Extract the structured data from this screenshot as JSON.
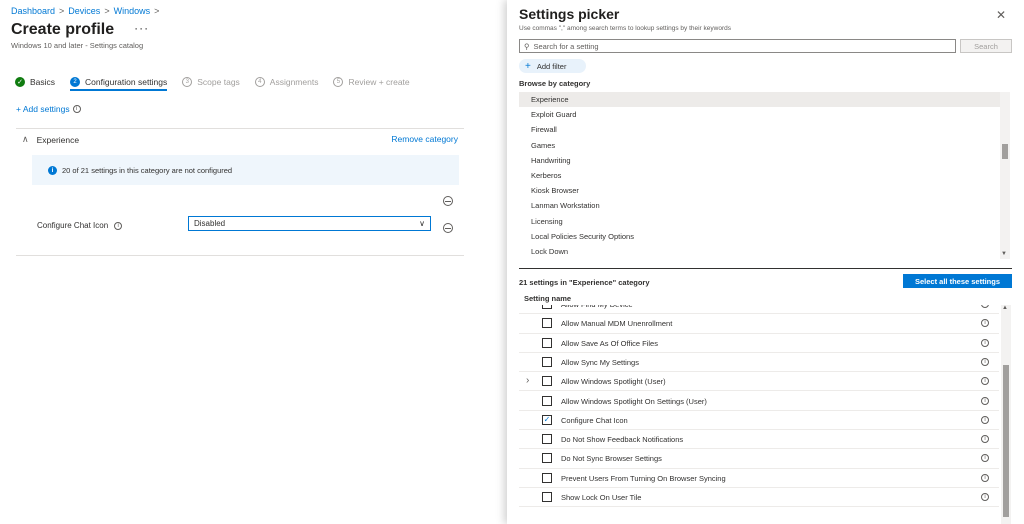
{
  "breadcrumb": [
    "Dashboard",
    "Devices",
    "Windows"
  ],
  "breadcrumb_sep": ">",
  "page": {
    "title": "Create profile",
    "more": "···",
    "subtitle": "Windows 10 and later - Settings catalog"
  },
  "wizard": {
    "steps": [
      {
        "num": "✓",
        "label": "Basics",
        "state": "done"
      },
      {
        "num": "2",
        "label": "Configuration settings",
        "state": "active"
      },
      {
        "num": "3",
        "label": "Scope tags",
        "state": "pending"
      },
      {
        "num": "4",
        "label": "Assignments",
        "state": "pending"
      },
      {
        "num": "5",
        "label": "Review + create",
        "state": "pending"
      }
    ]
  },
  "add_settings": {
    "label": "+ Add settings",
    "info": "i"
  },
  "category": {
    "name": "Experience",
    "collapse_icon": "chevron-up-icon",
    "remove_label": "Remove category",
    "info_text": "20 of 21 settings in this category are not configured",
    "info_glyph": "i",
    "setting_label": "Configure Chat Icon",
    "setting_info": "i",
    "dropdown_value": "Disabled",
    "dropdown_chevron": "∨"
  },
  "picker": {
    "title": "Settings picker",
    "close": "✕",
    "hint": "Use commas \",\" among search terms to lookup settings by their keywords",
    "search_placeholder": "Search for a setting",
    "search_icon": "⚲",
    "search_button": "Search",
    "add_filter": "Add filter",
    "add_filter_plus": "+",
    "browse_label": "Browse by category",
    "categories": [
      "Experience",
      "Exploit Guard",
      "Firewall",
      "Games",
      "Handwriting",
      "Kerberos",
      "Kiosk Browser",
      "Lanman Workstation",
      "Licensing",
      "Local Policies Security Options",
      "Lock Down"
    ],
    "selected_category": "Experience",
    "scroll_down": "▼",
    "scroll_up": "▲",
    "count_label": "21 settings in \"Experience\" category",
    "select_all": "Select all these settings",
    "column_header": "Setting name",
    "settings": [
      {
        "label": "Allow Find My Device",
        "checked": false,
        "expandable": false
      },
      {
        "label": "Allow Manual MDM Unenrollment",
        "checked": false,
        "expandable": false
      },
      {
        "label": "Allow Save As Of Office Files",
        "checked": false,
        "expandable": false
      },
      {
        "label": "Allow Sync My Settings",
        "checked": false,
        "expandable": false
      },
      {
        "label": "Allow Windows Spotlight (User)",
        "checked": false,
        "expandable": true
      },
      {
        "label": "Allow Windows Spotlight On Settings (User)",
        "checked": false,
        "expandable": false
      },
      {
        "label": "Configure Chat Icon",
        "checked": true,
        "expandable": false
      },
      {
        "label": "Do Not Show Feedback Notifications",
        "checked": false,
        "expandable": false
      },
      {
        "label": "Do Not Sync Browser Settings",
        "checked": false,
        "expandable": false
      },
      {
        "label": "Prevent Users From Turning On Browser Syncing",
        "checked": false,
        "expandable": false
      },
      {
        "label": "Show Lock On User Tile",
        "checked": false,
        "expandable": false
      }
    ],
    "row_info": "i",
    "check_glyph": "✓",
    "expand_glyph": "›"
  },
  "colors": {
    "accent": "#0078d4",
    "success": "#107c10",
    "info_bg": "#eff6fc",
    "selected_bg": "#edebe9"
  }
}
